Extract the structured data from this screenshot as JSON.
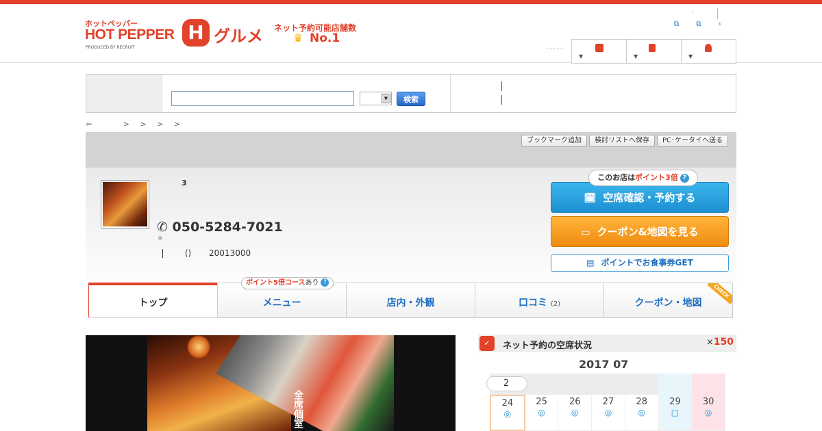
{
  "header": {
    "logo_small": "ホットペッパー",
    "logo_main": "HOT PEPPER",
    "logo_produced": "PRODUCED BY RECRUIT",
    "logo_h": "H",
    "logo_gourmet": "グルメ",
    "logo_net": "ネット予約可能店舗数",
    "logo_no1": "No.1",
    "links": [
      "⧉",
      "⧉",
      "›"
    ],
    "dot": "-"
  },
  "search": {
    "button_label": "検索",
    "select_arrow": "▼"
  },
  "breadcrumb": {
    "back": "⬅",
    "items": [
      ">",
      ">",
      ">",
      ">"
    ]
  },
  "shop": {
    "util_buttons": [
      "ブックマーク追加",
      "検討リストへ保存",
      "PC･ケータイへ送る"
    ],
    "number_label": "3",
    "phone_icon": "✆",
    "phone": "050-5284-7021",
    "phone_note": "※",
    "info_paren": "()",
    "info_value": "20013000"
  },
  "point_bubble": {
    "prefix": "このお店は",
    "highlight": "ポイント3倍",
    "help": "?"
  },
  "actions": {
    "reserve_icon": "🗓",
    "reserve_label": "空席確認・予約する",
    "coupon_icon": "▭",
    "coupon_label": "クーポン&地図を見る",
    "point_icon": "▤",
    "point_label": "ポイントでお食事券GET"
  },
  "tabs": {
    "badge_highlight": "ポイント5倍コース",
    "badge_suffix": "あり",
    "badge_help": "?",
    "items": [
      {
        "label": "トップ"
      },
      {
        "label": "メニュー"
      },
      {
        "label": "店内・外観"
      },
      {
        "label": "口コミ",
        "count": "(2)"
      },
      {
        "label": "クーポン・地図"
      }
    ],
    "check": "CHECK"
  },
  "photo": {
    "caption": "全席個室"
  },
  "availability": {
    "icon": "✓",
    "title": "ネット予約の空席状況",
    "points_prefix": "×",
    "points_value": "150",
    "month": "2017 07",
    "bubble": "2",
    "days": [
      {
        "day": "24",
        "mark": "◎"
      },
      {
        "day": "25",
        "mark": "◎"
      },
      {
        "day": "26",
        "mark": "◎"
      },
      {
        "day": "27",
        "mark": "◎"
      },
      {
        "day": "28",
        "mark": "◎"
      },
      {
        "day": "29",
        "mark": "□"
      },
      {
        "day": "30",
        "mark": "◎"
      }
    ]
  }
}
